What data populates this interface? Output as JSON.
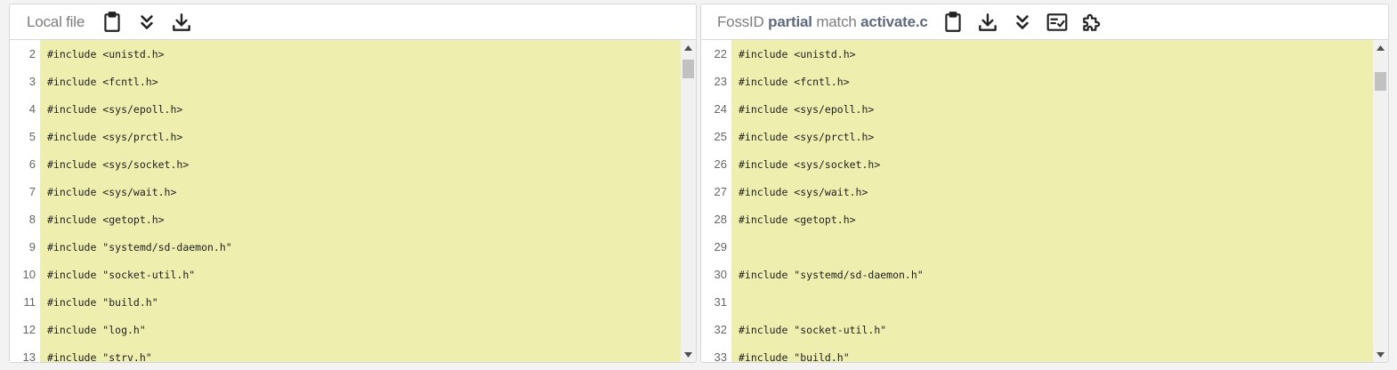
{
  "left": {
    "title": "Local file",
    "icons": [
      "clipboard-icon",
      "double-chevron-down-icon",
      "download-icon"
    ],
    "lines": [
      {
        "num": "2",
        "code": "#include <unistd.h>"
      },
      {
        "num": "3",
        "code": "#include <fcntl.h>"
      },
      {
        "num": "4",
        "code": "#include <sys/epoll.h>"
      },
      {
        "num": "5",
        "code": "#include <sys/prctl.h>"
      },
      {
        "num": "6",
        "code": "#include <sys/socket.h>"
      },
      {
        "num": "7",
        "code": "#include <sys/wait.h>"
      },
      {
        "num": "8",
        "code": "#include <getopt.h>"
      },
      {
        "num": "9",
        "code": "#include \"systemd/sd-daemon.h\""
      },
      {
        "num": "10",
        "code": "#include \"socket-util.h\""
      },
      {
        "num": "11",
        "code": "#include \"build.h\""
      },
      {
        "num": "12",
        "code": "#include \"log.h\""
      },
      {
        "num": "13",
        "code": "#include \"strv.h\""
      }
    ]
  },
  "right": {
    "title_prefix": "FossID",
    "title_bold1": "partial",
    "title_middle": "match",
    "title_bold2": "activate.c",
    "icons": [
      "clipboard-icon",
      "download-icon",
      "double-chevron-down-icon",
      "checklist-icon",
      "puzzle-icon"
    ],
    "lines": [
      {
        "num": "22",
        "code": "#include <unistd.h>"
      },
      {
        "num": "23",
        "code": "#include <fcntl.h>"
      },
      {
        "num": "24",
        "code": "#include <sys/epoll.h>"
      },
      {
        "num": "25",
        "code": "#include <sys/prctl.h>"
      },
      {
        "num": "26",
        "code": "#include <sys/socket.h>"
      },
      {
        "num": "27",
        "code": "#include <sys/wait.h>"
      },
      {
        "num": "28",
        "code": "#include <getopt.h>"
      },
      {
        "num": "29",
        "code": ""
      },
      {
        "num": "30",
        "code": "#include \"systemd/sd-daemon.h\""
      },
      {
        "num": "31",
        "code": ""
      },
      {
        "num": "32",
        "code": "#include \"socket-util.h\""
      },
      {
        "num": "33",
        "code": "#include \"build.h\""
      }
    ]
  },
  "colors": {
    "highlight": "#eeeeaf",
    "title_text": "#7d7d7d",
    "title_bold": "#5f6b7c"
  }
}
